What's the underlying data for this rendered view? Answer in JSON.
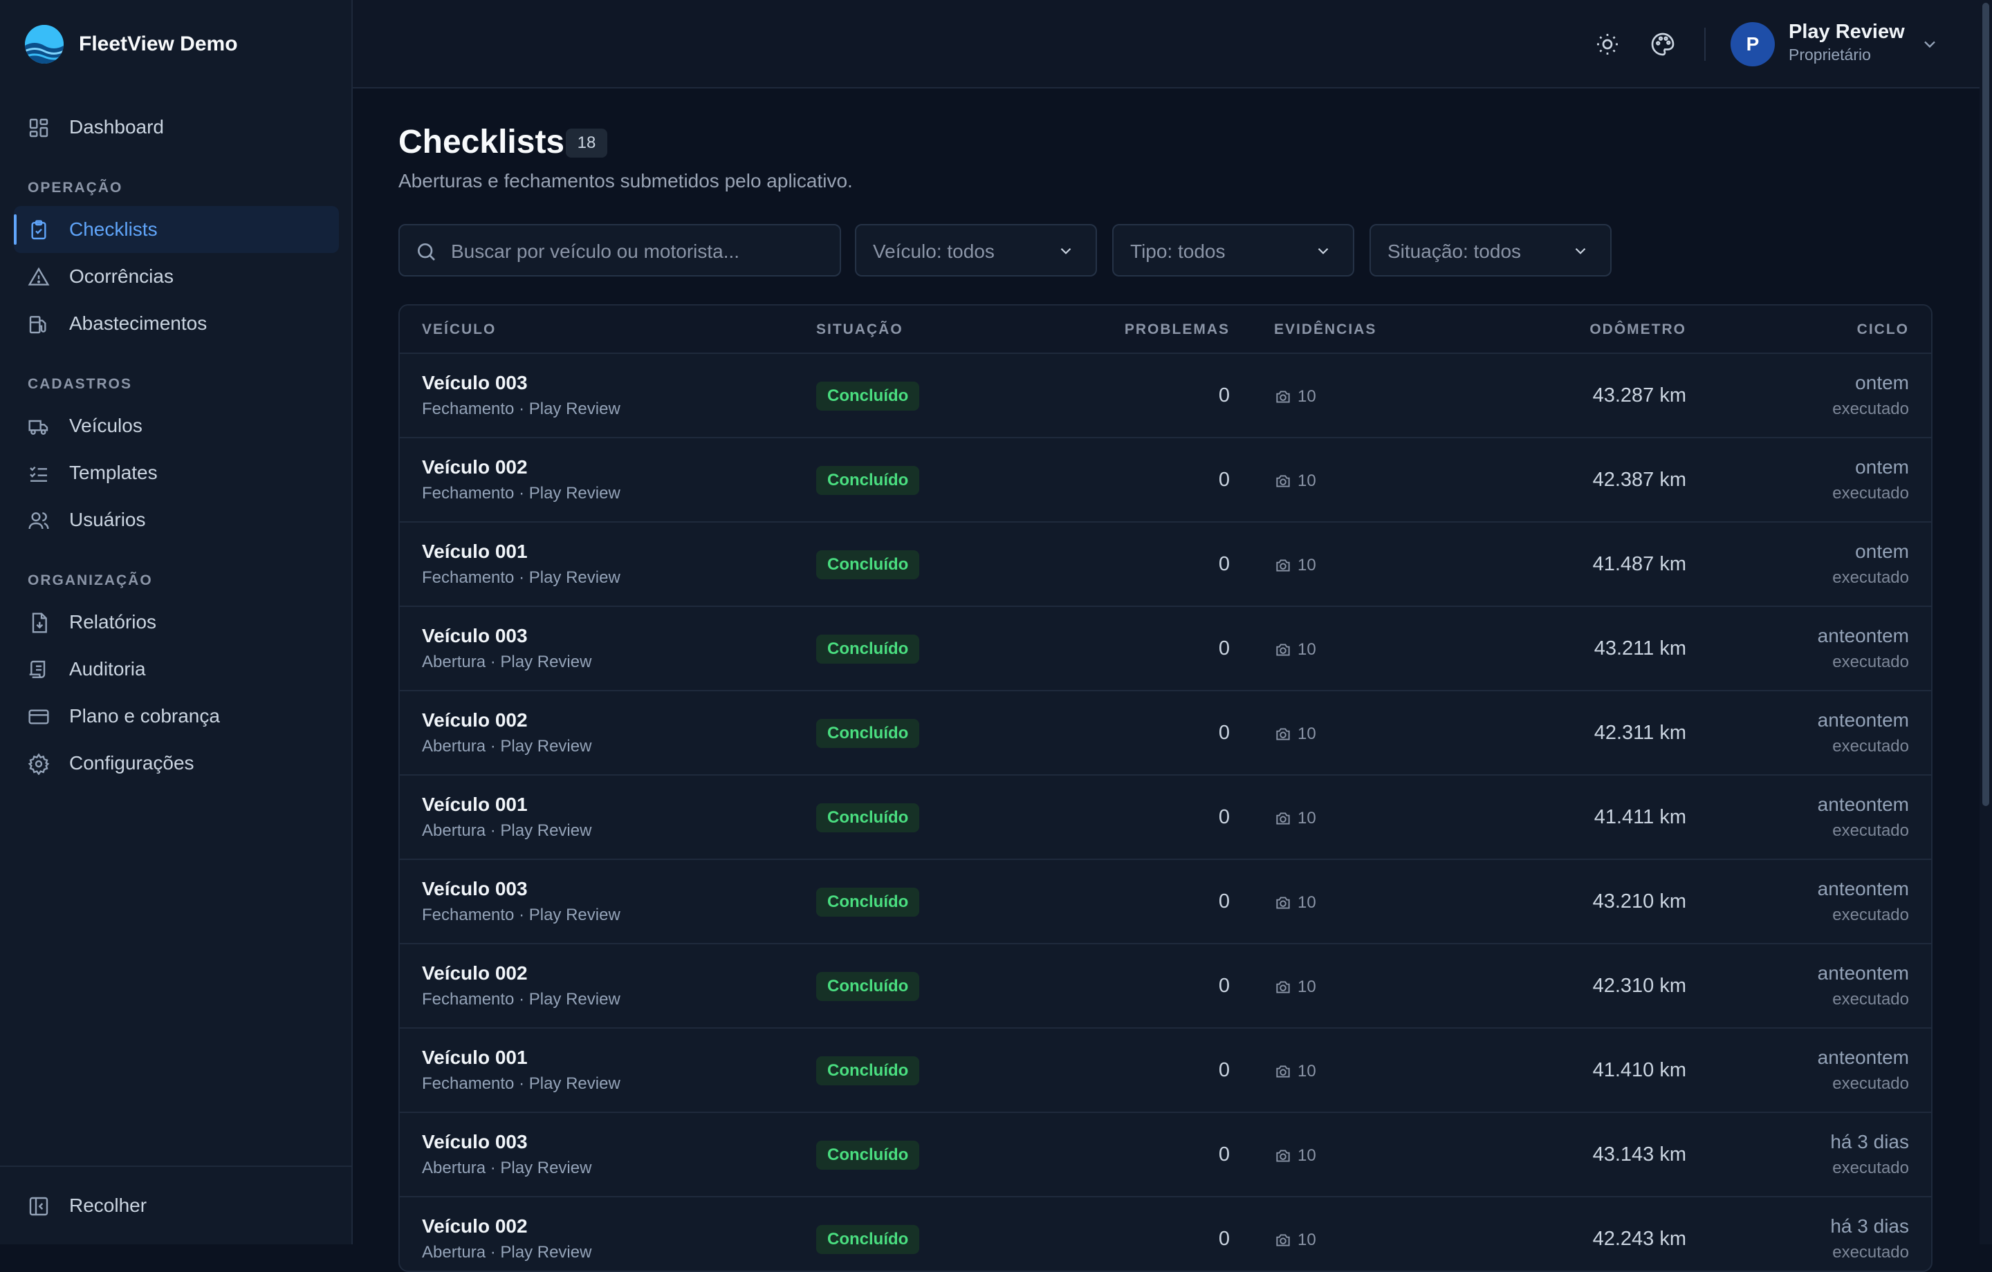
{
  "app": {
    "name": "FleetView Demo"
  },
  "sidebar": {
    "dashboard": {
      "label": "Dashboard",
      "icon": "dashboard-icon"
    },
    "sections": [
      {
        "label": "OPERAÇÃO",
        "items": [
          {
            "label": "Checklists",
            "icon": "clipboard-check-icon",
            "active": true
          },
          {
            "label": "Ocorrências",
            "icon": "warning-icon"
          },
          {
            "label": "Abastecimentos",
            "icon": "fuel-icon"
          }
        ]
      },
      {
        "label": "CADASTROS",
        "items": [
          {
            "label": "Veículos",
            "icon": "truck-icon"
          },
          {
            "label": "Templates",
            "icon": "list-checks-icon"
          },
          {
            "label": "Usuários",
            "icon": "users-icon"
          }
        ]
      },
      {
        "label": "ORGANIZAÇÃO",
        "items": [
          {
            "label": "Relatórios",
            "icon": "file-download-icon"
          },
          {
            "label": "Auditoria",
            "icon": "scroll-icon"
          },
          {
            "label": "Plano e cobrança",
            "icon": "credit-card-icon"
          },
          {
            "label": "Configurações",
            "icon": "gear-icon"
          }
        ]
      }
    ],
    "collapse_label": "Recolher"
  },
  "topbar": {
    "user": {
      "initial": "P",
      "name": "Play Review",
      "role": "Proprietário"
    }
  },
  "page": {
    "title": "Checklists",
    "count": "18",
    "subtitle": "Aberturas e fechamentos submetidos pelo aplicativo."
  },
  "filters": {
    "search_placeholder": "Buscar por veículo ou motorista...",
    "vehicle": "Veículo: todos",
    "type": "Tipo: todos",
    "status": "Situação: todos"
  },
  "table": {
    "columns": {
      "vehicle": "VEÍCULO",
      "status": "SITUAÇÃO",
      "problems": "PROBLEMAS",
      "evidence": "EVIDÊNCIAS",
      "odometer": "ODÔMETRO",
      "cycle": "CICLO"
    },
    "rows": [
      {
        "vehicle": "Veículo 003",
        "sub": "Fechamento · Play Review",
        "status": "Concluído",
        "problems": "0",
        "evidence": "10",
        "odometer": "43.287 km",
        "when": "ontem",
        "cycle": "executado"
      },
      {
        "vehicle": "Veículo 002",
        "sub": "Fechamento · Play Review",
        "status": "Concluído",
        "problems": "0",
        "evidence": "10",
        "odometer": "42.387 km",
        "when": "ontem",
        "cycle": "executado"
      },
      {
        "vehicle": "Veículo 001",
        "sub": "Fechamento · Play Review",
        "status": "Concluído",
        "problems": "0",
        "evidence": "10",
        "odometer": "41.487 km",
        "when": "ontem",
        "cycle": "executado"
      },
      {
        "vehicle": "Veículo 003",
        "sub": "Abertura · Play Review",
        "status": "Concluído",
        "problems": "0",
        "evidence": "10",
        "odometer": "43.211 km",
        "when": "anteontem",
        "cycle": "executado"
      },
      {
        "vehicle": "Veículo 002",
        "sub": "Abertura · Play Review",
        "status": "Concluído",
        "problems": "0",
        "evidence": "10",
        "odometer": "42.311 km",
        "when": "anteontem",
        "cycle": "executado"
      },
      {
        "vehicle": "Veículo 001",
        "sub": "Abertura · Play Review",
        "status": "Concluído",
        "problems": "0",
        "evidence": "10",
        "odometer": "41.411 km",
        "when": "anteontem",
        "cycle": "executado"
      },
      {
        "vehicle": "Veículo 003",
        "sub": "Fechamento · Play Review",
        "status": "Concluído",
        "problems": "0",
        "evidence": "10",
        "odometer": "43.210 km",
        "when": "anteontem",
        "cycle": "executado"
      },
      {
        "vehicle": "Veículo 002",
        "sub": "Fechamento · Play Review",
        "status": "Concluído",
        "problems": "0",
        "evidence": "10",
        "odometer": "42.310 km",
        "when": "anteontem",
        "cycle": "executado"
      },
      {
        "vehicle": "Veículo 001",
        "sub": "Fechamento · Play Review",
        "status": "Concluído",
        "problems": "0",
        "evidence": "10",
        "odometer": "41.410 km",
        "when": "anteontem",
        "cycle": "executado"
      },
      {
        "vehicle": "Veículo 003",
        "sub": "Abertura · Play Review",
        "status": "Concluído",
        "problems": "0",
        "evidence": "10",
        "odometer": "43.143 km",
        "when": "há 3 dias",
        "cycle": "executado"
      },
      {
        "vehicle": "Veículo 002",
        "sub": "Abertura · Play Review",
        "status": "Concluído",
        "problems": "0",
        "evidence": "10",
        "odometer": "42.243 km",
        "when": "há 3 dias",
        "cycle": "executado"
      }
    ]
  },
  "colors": {
    "background": "#0b1220",
    "sidebar": "#111a29",
    "accent": "#60a5fa",
    "success": "#4ade80",
    "avatar": "#1e4ea8"
  }
}
